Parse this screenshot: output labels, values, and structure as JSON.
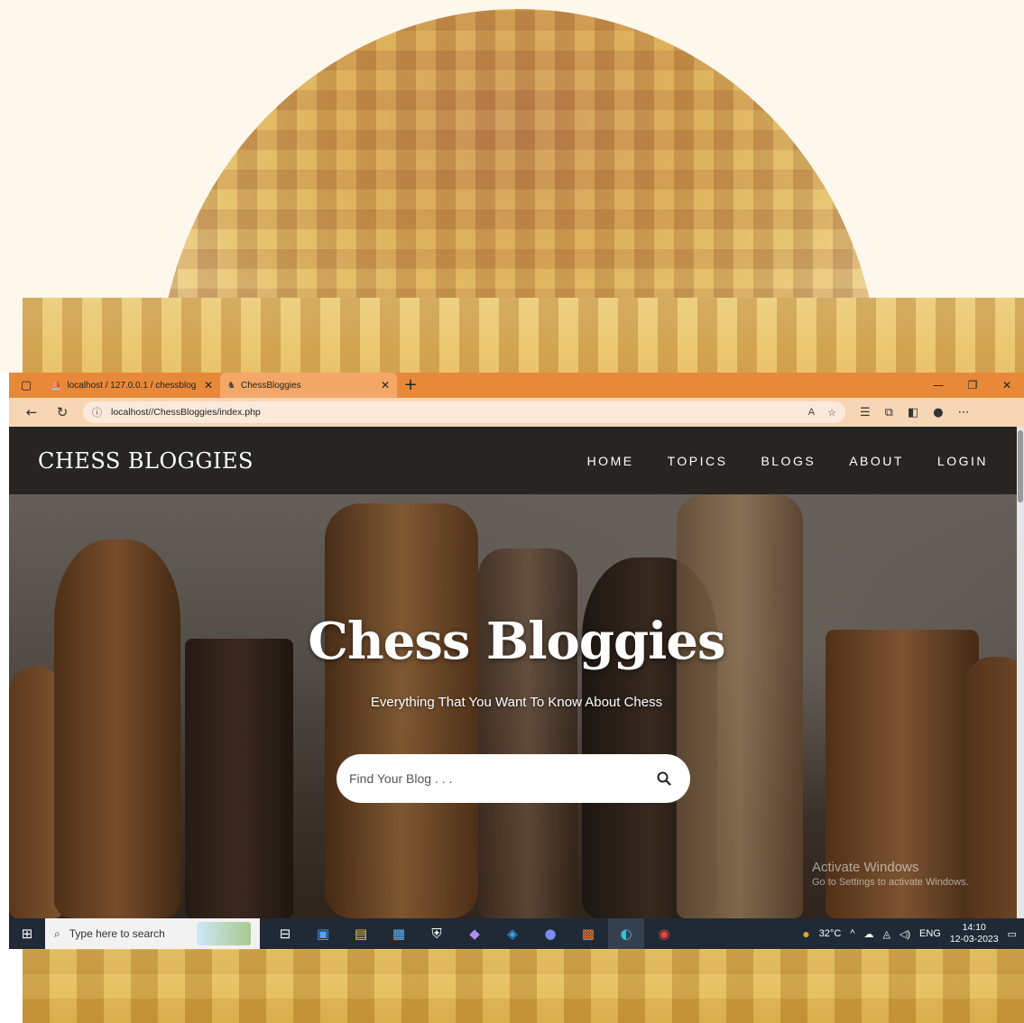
{
  "browser": {
    "tabs": [
      {
        "label": "localhost / 127.0.0.1 / chessblog",
        "active": false
      },
      {
        "label": "ChessBloggies",
        "active": true
      }
    ],
    "new_tab": "+",
    "url": "localhost//ChessBloggies/index.php"
  },
  "site": {
    "brand": "CHESS BLOGGIES",
    "menu": [
      "HOME",
      "TOPICS",
      "BLOGS",
      "ABOUT",
      "LOGIN"
    ],
    "hero": {
      "title": "Chess Bloggies",
      "subtitle": "Everything That You Want To Know About Chess",
      "search_placeholder": "Find Your Blog . . ."
    }
  },
  "watermark": {
    "line1": "Activate Windows",
    "line2": "Go to Settings to activate Windows."
  },
  "taskbar": {
    "search_placeholder": "Type here to search",
    "temperature": "32°C",
    "language": "ENG",
    "time": "14:10",
    "date": "12-03-2023"
  },
  "colors": {
    "tab_strip": "#e8893a",
    "address_bar": "#f6d6b4",
    "site_nav": "#262524",
    "taskbar": "#1f2a36"
  }
}
